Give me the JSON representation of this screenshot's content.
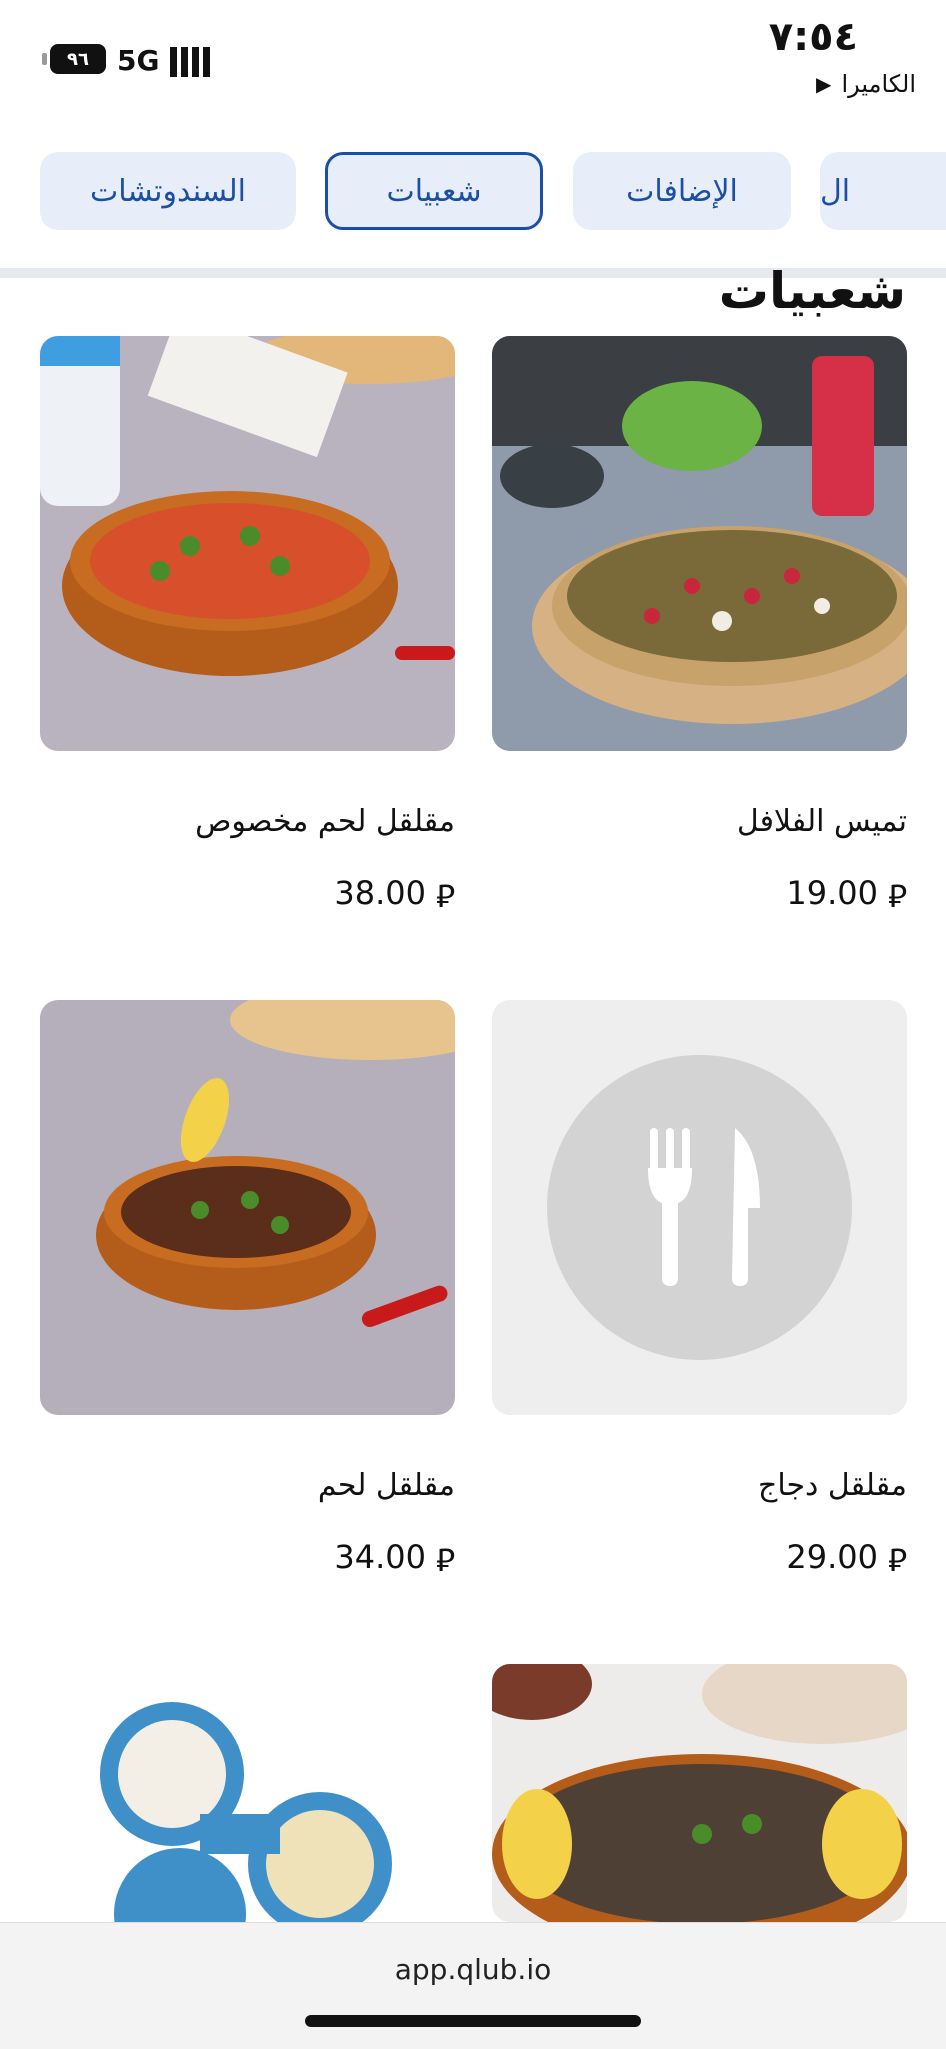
{
  "status_bar": {
    "time": "٧:٥٤",
    "back_label": "الكاميرا",
    "battery": "٩٦",
    "network": "5G"
  },
  "tabs": [
    {
      "label": "السندوتشات",
      "active": false
    },
    {
      "label": "شعبيات",
      "active": true
    },
    {
      "label": "الإضافات",
      "active": false
    },
    {
      "label": "ال",
      "active": false
    }
  ],
  "section": {
    "title": "شعبيات"
  },
  "products": [
    {
      "name": "تميس الفلافل",
      "price": "19.00",
      "currency": "⃁",
      "image": "falafel-tamees"
    },
    {
      "name": "مقلقل لحم مخصوص",
      "price": "38.00",
      "currency": "⃁",
      "image": "meat-stew-special"
    },
    {
      "name": "مقلقل دجاج",
      "price": "29.00",
      "currency": "⃁",
      "image": "placeholder-fork-knife-icon"
    },
    {
      "name": "مقلقل لحم",
      "price": "34.00",
      "currency": "⃁",
      "image": "meat-stew"
    },
    {
      "name": "",
      "price": "",
      "currency": "",
      "image": "liver-with-lemon"
    },
    {
      "name": "",
      "price": "",
      "currency": "",
      "image": "breakfast-platter"
    }
  ],
  "browser": {
    "url": "app.qlub.io"
  },
  "colors": {
    "accent": "#1b4fa5",
    "tab_bg": "#e8eef9",
    "placeholder_bg": "#eeeeee"
  }
}
